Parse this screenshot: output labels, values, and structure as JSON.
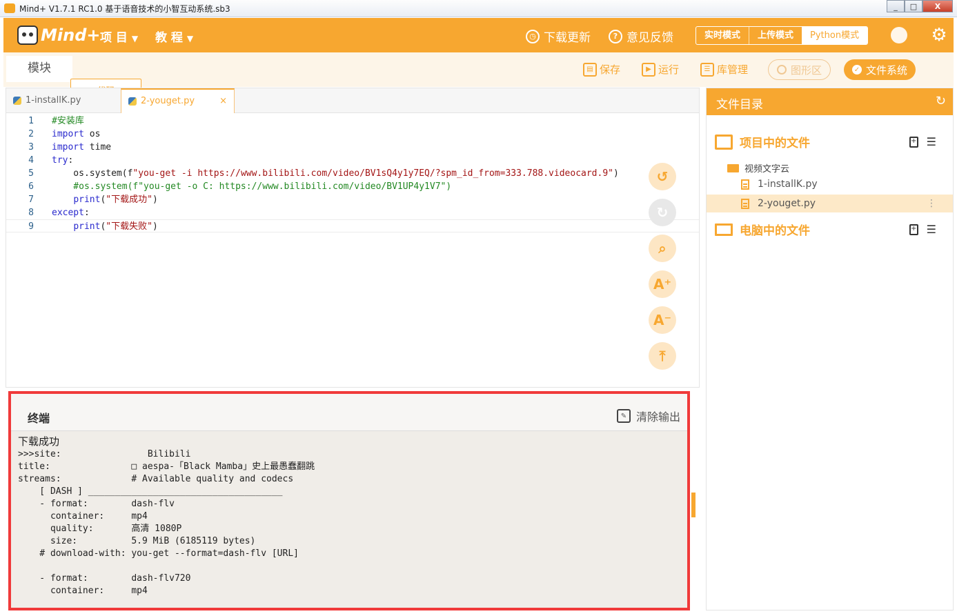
{
  "window": {
    "title": "Mind+ V1.7.1 RC1.0   基于语音技术的小智互动系统.sb3",
    "btn_min": "_",
    "btn_max": "□",
    "btn_close": "X"
  },
  "topbar": {
    "logo_text": "Mind+",
    "menu_project": "项 目",
    "menu_tutorial": "教 程",
    "caret": "▼",
    "download_update": "下载更新",
    "feedback": "意见反馈",
    "modes": [
      "实时模式",
      "上传模式",
      "Python模式"
    ],
    "active_mode": "Python模式",
    "accent": "#f7a730"
  },
  "toolbar": {
    "tab_blocks": "模块",
    "tab_code": "代码",
    "save": "保存",
    "run": "运行",
    "library": "库管理",
    "graphics": "图形区",
    "filesystem": "文件系统"
  },
  "editor": {
    "tabs": [
      "1-installK.py",
      "2-youget.py"
    ],
    "active_tab": "2-youget.py",
    "close_glyph": "×",
    "lines": [
      {
        "n": "1",
        "parts": [
          {
            "t": "#安装库",
            "c": "cm"
          }
        ]
      },
      {
        "n": "2",
        "parts": [
          {
            "t": "import",
            "c": "kw"
          },
          {
            "t": " os",
            "c": "plain"
          }
        ]
      },
      {
        "n": "3",
        "parts": [
          {
            "t": "import",
            "c": "kw"
          },
          {
            "t": " time",
            "c": "plain"
          }
        ]
      },
      {
        "n": "4",
        "parts": [
          {
            "t": "try",
            "c": "kw"
          },
          {
            "t": ":",
            "c": "plain"
          }
        ]
      },
      {
        "n": "5",
        "parts": [
          {
            "t": "    os.system(f",
            "c": "plain"
          },
          {
            "t": "\"you-get -i https://www.bilibili.com/video/BV1sQ4y1y7EQ/?spm_id_from=333.788.videocard.9\"",
            "c": "st"
          },
          {
            "t": ")",
            "c": "plain"
          }
        ]
      },
      {
        "n": "6",
        "parts": [
          {
            "t": "    #os.system(f\"you-get -o C: https://www.bilibili.com/video/BV1UP4y1V7\")",
            "c": "cm"
          }
        ]
      },
      {
        "n": "7",
        "parts": [
          {
            "t": "    ",
            "c": "plain"
          },
          {
            "t": "print",
            "c": "fn"
          },
          {
            "t": "(",
            "c": "plain"
          },
          {
            "t": "\"下载成功\"",
            "c": "st"
          },
          {
            "t": ")",
            "c": "plain"
          }
        ]
      },
      {
        "n": "8",
        "parts": [
          {
            "t": "except",
            "c": "kw"
          },
          {
            "t": ":",
            "c": "plain"
          }
        ]
      },
      {
        "n": "9",
        "parts": [
          {
            "t": "    ",
            "c": "plain"
          },
          {
            "t": "print",
            "c": "fn"
          },
          {
            "t": "(",
            "c": "plain"
          },
          {
            "t": "\"下载失败\"",
            "c": "st"
          },
          {
            "t": ")",
            "c": "plain"
          }
        ]
      }
    ],
    "side_tools": [
      {
        "name": "undo-button",
        "glyph": "↺",
        "enabled": true
      },
      {
        "name": "redo-button",
        "glyph": "↻",
        "enabled": false
      },
      {
        "name": "search-button",
        "glyph": "⌕",
        "enabled": true
      },
      {
        "name": "font-increase-button",
        "glyph": "A⁺",
        "enabled": true
      },
      {
        "name": "font-decrease-button",
        "glyph": "A⁻",
        "enabled": true
      },
      {
        "name": "scroll-top-button",
        "glyph": "⤒",
        "enabled": true
      }
    ]
  },
  "terminal": {
    "title": "终端",
    "clear_label": "清除输出",
    "first_line": "下载成功",
    "lines": [
      ">>>site:                Bilibili",
      "title:               □ aespa-「Black Mamba」史上最愚蠢翻跳",
      "streams:             # Available quality and codecs",
      "    [ DASH ] ____________________________________",
      "    - format:        dash-flv",
      "      container:     mp4",
      "      quality:       高清 1080P",
      "      size:          5.9 MiB (6185119 bytes)",
      "    # download-with: you-get --format=dash-flv [URL]",
      "",
      "    - format:        dash-flv720",
      "      container:     mp4"
    ]
  },
  "files": {
    "header": "文件目录",
    "refresh_glyph": "↻",
    "project_section": "项目中的文件",
    "folder_name": "视频文字云",
    "items": [
      "1-installK.py",
      "2-youget.py"
    ],
    "selected": "2-youget.py",
    "more_glyph": "⋮",
    "computer_section": "电脑中的文件",
    "add_glyph": "+",
    "menu_glyph": "☰"
  }
}
